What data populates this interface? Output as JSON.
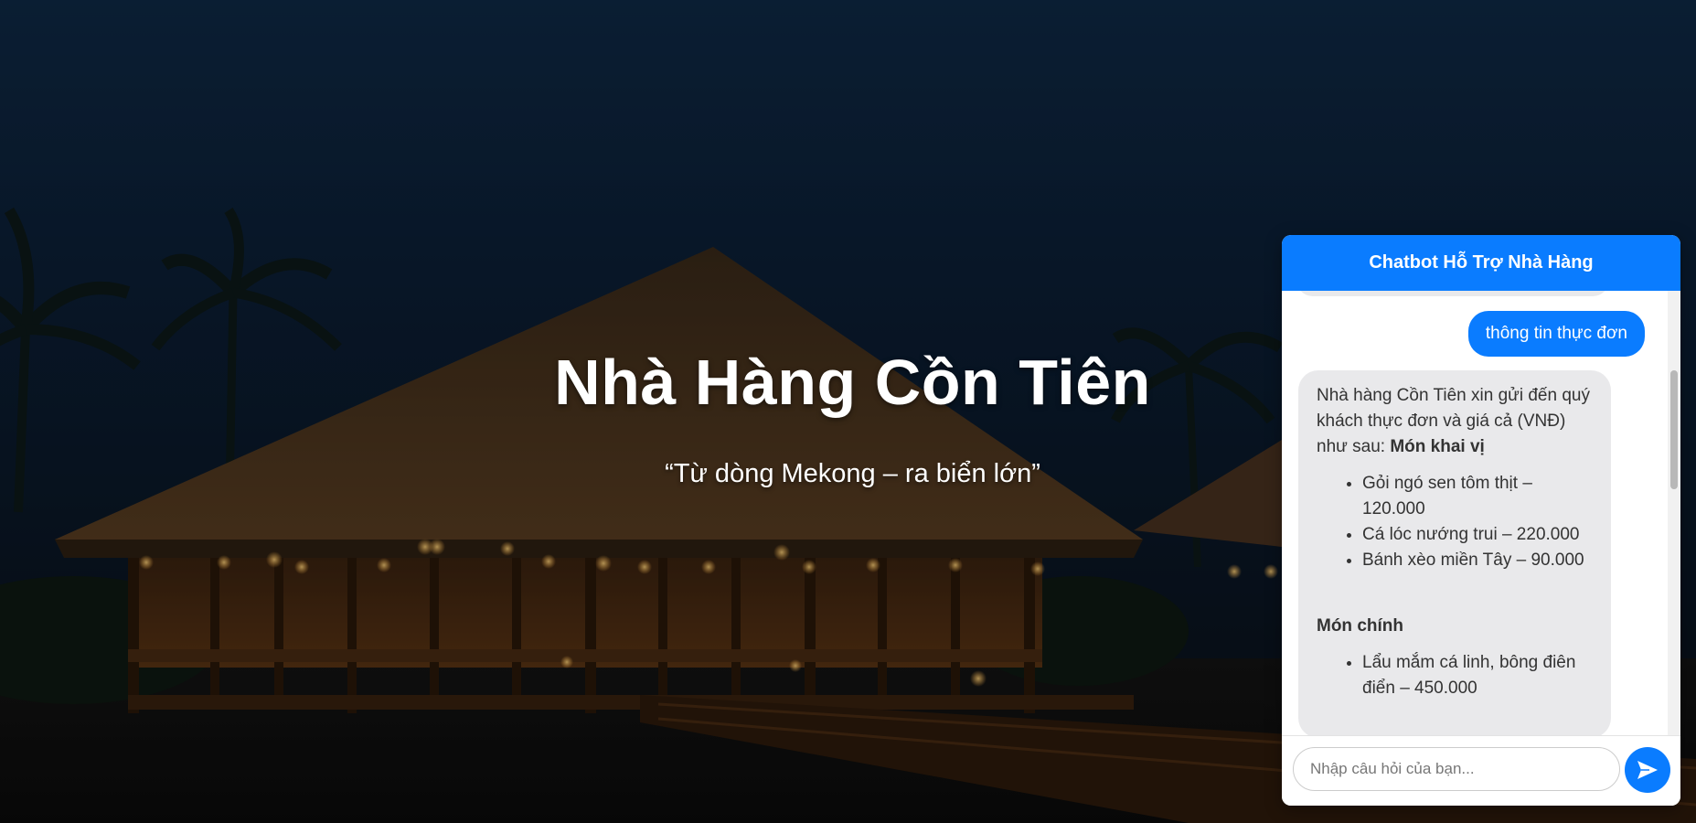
{
  "hero": {
    "title": "Nhà Hàng Cồn Tiên",
    "tagline": "“Từ dòng Mekong – ra biển lớn”"
  },
  "chatbot": {
    "header_title": "Chatbot Hỗ Trợ Nhà Hàng",
    "user_message": "thông tin thực đơn",
    "bot_reply": {
      "intro": "Nhà hàng Cồn Tiên xin gửi đến quý khách thực đơn và giá cả (VNĐ) như sau: ",
      "section_1_title": "Món khai vị",
      "section_1_items": [
        "Gỏi ngó sen tôm thịt – 120.000",
        "Cá lóc nướng trui – 220.000",
        "Bánh xèo miền Tây – 90.000"
      ],
      "section_2_title": "Món chính",
      "section_2_items": [
        "Lẩu mắm cá linh, bông điên điển – 450.000"
      ]
    },
    "input_placeholder": "Nhập câu hỏi của bạn...",
    "send_icon": "send-arrow-icon"
  },
  "colors": {
    "accent": "#0a7cff",
    "bot_bubble": "#e9e9eb",
    "sky": "#0f2a47"
  }
}
